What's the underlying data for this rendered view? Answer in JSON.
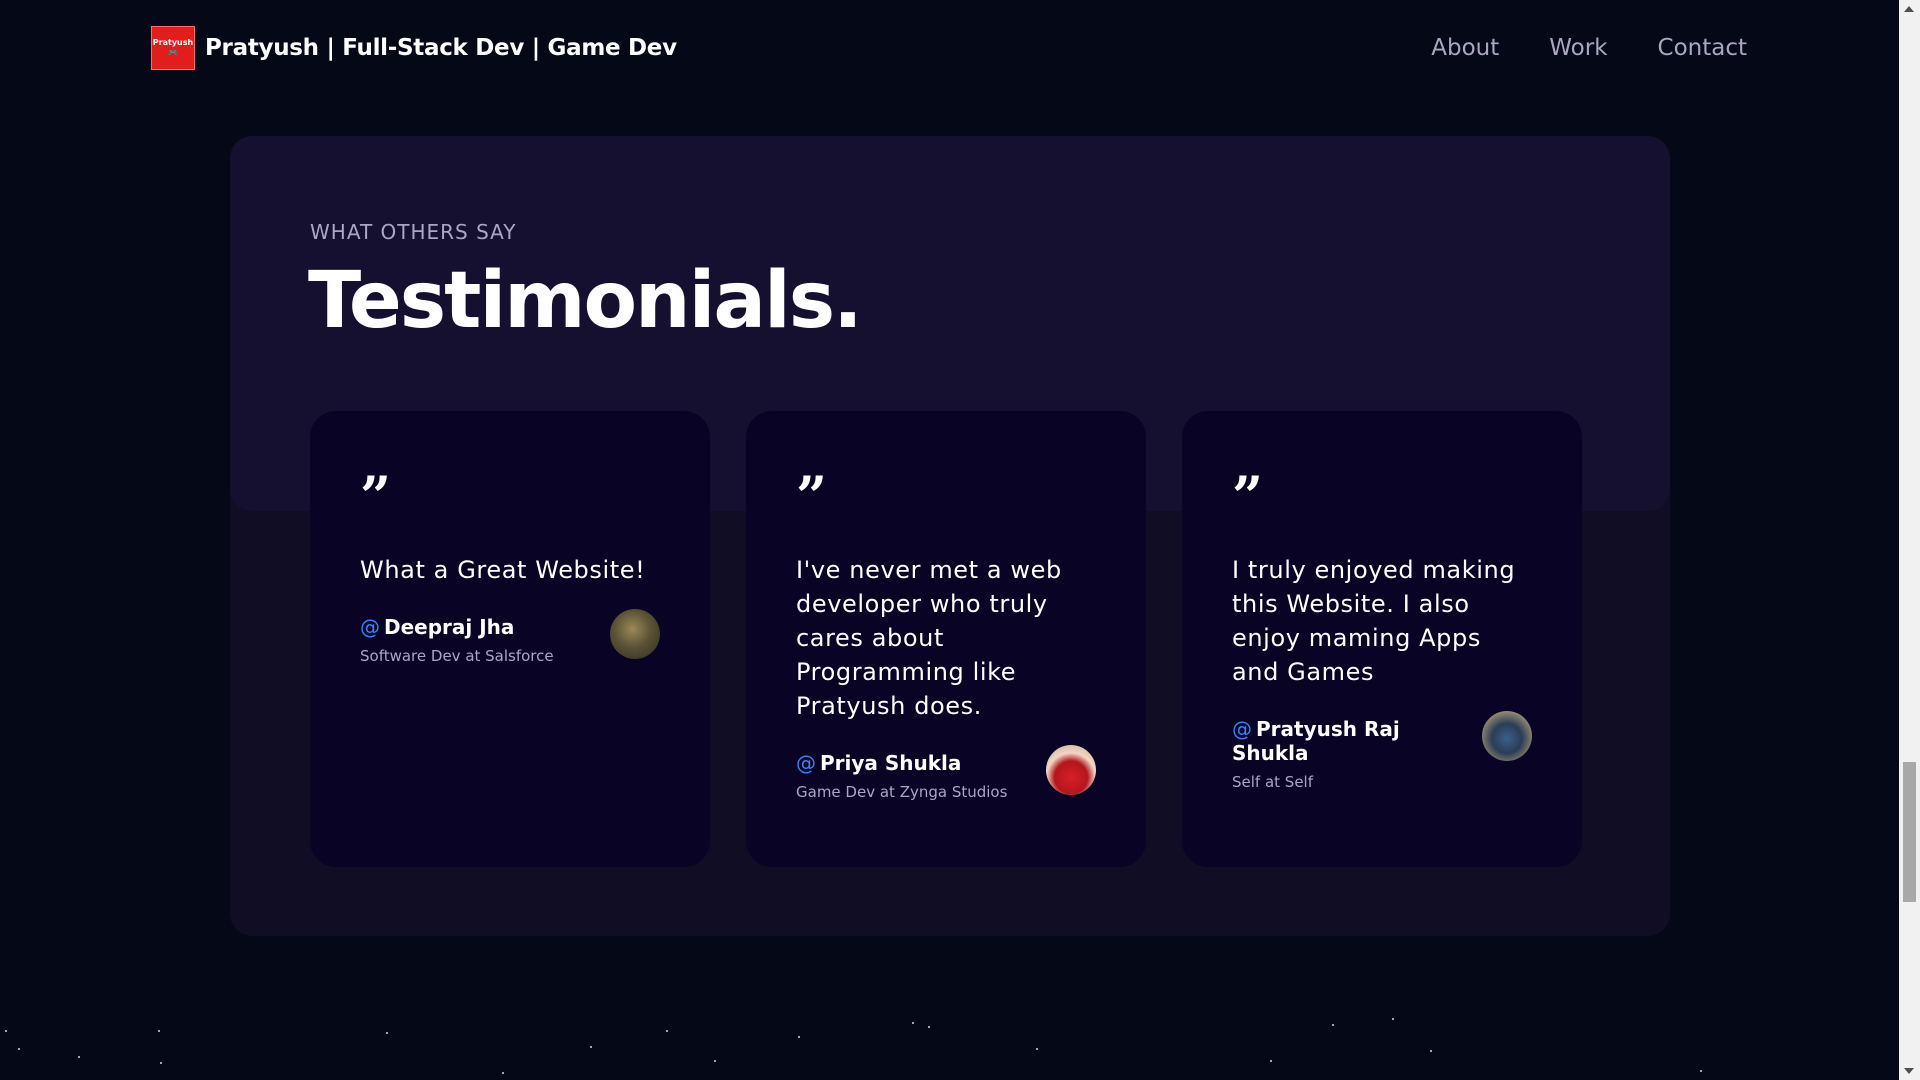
{
  "navbar": {
    "logo_text": "Pratyush",
    "brand_title": "Pratyush |  Full-Stack Dev | Game Dev",
    "links": [
      "About",
      "Work",
      "Contact"
    ]
  },
  "section": {
    "subtitle": "What others say",
    "title": "Testimonials."
  },
  "testimonials": [
    {
      "quote_mark": "”",
      "text": "What a Great Website!",
      "at": "@",
      "name": "Deepraj Jha",
      "role": "Software Dev at Salsforce"
    },
    {
      "quote_mark": "”",
      "text": "I've never met a web developer who truly cares about Programming like Pratyush does.",
      "at": "@",
      "name": "Priya Shukla",
      "role": "Game Dev at Zynga Studios"
    },
    {
      "quote_mark": "”",
      "text": "I truly enjoyed making this Website. I also enjoy maming Apps and Games",
      "at": "@",
      "name": "Pratyush Raj Shukla",
      "role": "Self at Self"
    }
  ],
  "colors": {
    "background": "#050816",
    "section_bg": "#100d25",
    "section_head_bg": "#151030",
    "card_bg": "#090325",
    "secondary_text": "#aaa6c3",
    "at_accent": "#3b82f6",
    "logo_red": "#e11d1d"
  }
}
